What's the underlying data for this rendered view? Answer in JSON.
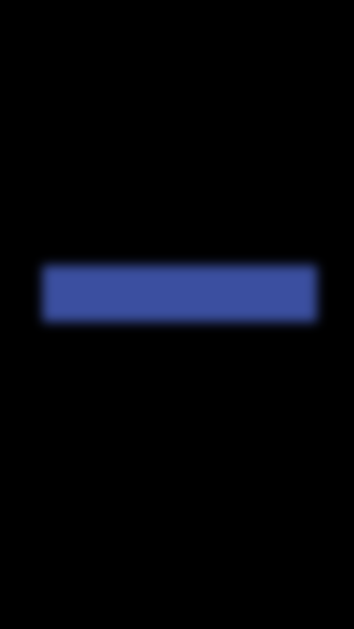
{
  "screen": {
    "background_color": "#000000",
    "primary_button": {
      "label": "",
      "color": "#3b4fa0"
    },
    "secondary_text": {
      "label": "",
      "color": "#e0e0e0"
    }
  }
}
